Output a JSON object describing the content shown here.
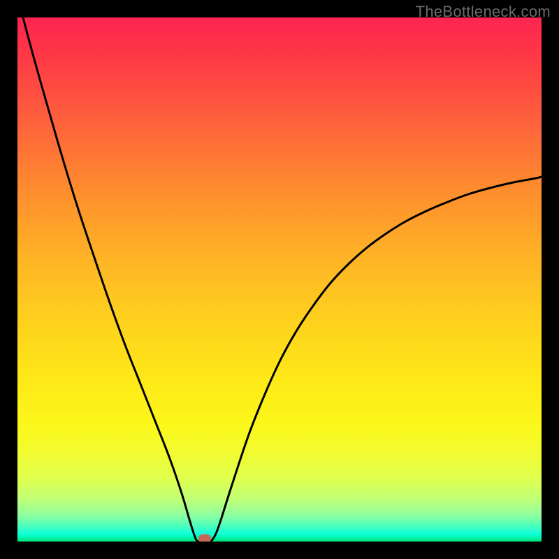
{
  "watermark": "TheBottleneck.com",
  "chart_data": {
    "type": "line",
    "title": "",
    "xlabel": "",
    "ylabel": "",
    "xlim": [
      0,
      100
    ],
    "ylim": [
      0,
      100
    ],
    "grid": false,
    "legend": false,
    "series": [
      {
        "name": "curve",
        "x": [
          0.0,
          2.9,
          5.9,
          8.8,
          11.7,
          14.7,
          17.6,
          20.5,
          23.5,
          26.3,
          29.0,
          31.3,
          32.9,
          33.9,
          34.5,
          35.6,
          36.5,
          37.3,
          38.4,
          40.8,
          44.1,
          47.2,
          50.2,
          53.3,
          56.5,
          59.7,
          63.1,
          66.7,
          70.4,
          74.1,
          78.1,
          82.1,
          86.1,
          90.3,
          94.5,
          98.8,
          100.0
        ],
        "y": [
          104.0,
          93.1,
          82.5,
          72.5,
          63.1,
          54.1,
          45.6,
          37.6,
          30.0,
          22.9,
          16.0,
          9.3,
          3.9,
          0.8,
          0.0,
          0.0,
          0.0,
          0.5,
          2.9,
          10.4,
          20.3,
          28.1,
          34.7,
          40.3,
          45.1,
          49.3,
          52.9,
          56.1,
          58.8,
          61.1,
          63.1,
          64.8,
          66.3,
          67.5,
          68.5,
          69.3,
          69.6
        ]
      }
    ],
    "marker": {
      "x_fraction": 0.357,
      "y_fraction": 0.0
    },
    "background_gradient": {
      "direction": "vertical",
      "stops": [
        {
          "offset": 0.0,
          "color": "#fe2551"
        },
        {
          "offset": 0.5,
          "color": "#feb126"
        },
        {
          "offset": 0.8,
          "color": "#feea17"
        },
        {
          "offset": 1.0,
          "color": "#00e276"
        }
      ]
    }
  }
}
